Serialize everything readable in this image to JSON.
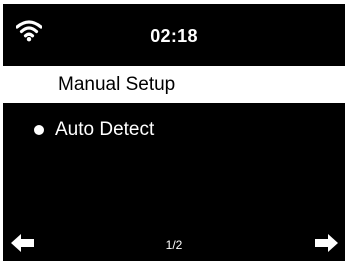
{
  "status_bar": {
    "wifi_icon": "wifi-icon",
    "time": "02:18"
  },
  "menu": {
    "items": [
      {
        "label": "Manual Setup",
        "selected": true
      },
      {
        "label": "Auto Detect",
        "selected": false,
        "marked": true
      }
    ]
  },
  "navigation": {
    "page": "1/2",
    "left_icon": "arrow-left-icon",
    "right_icon": "arrow-right-icon"
  },
  "colors": {
    "background": "#000000",
    "foreground": "#ffffff",
    "highlight": "#ffffff"
  }
}
